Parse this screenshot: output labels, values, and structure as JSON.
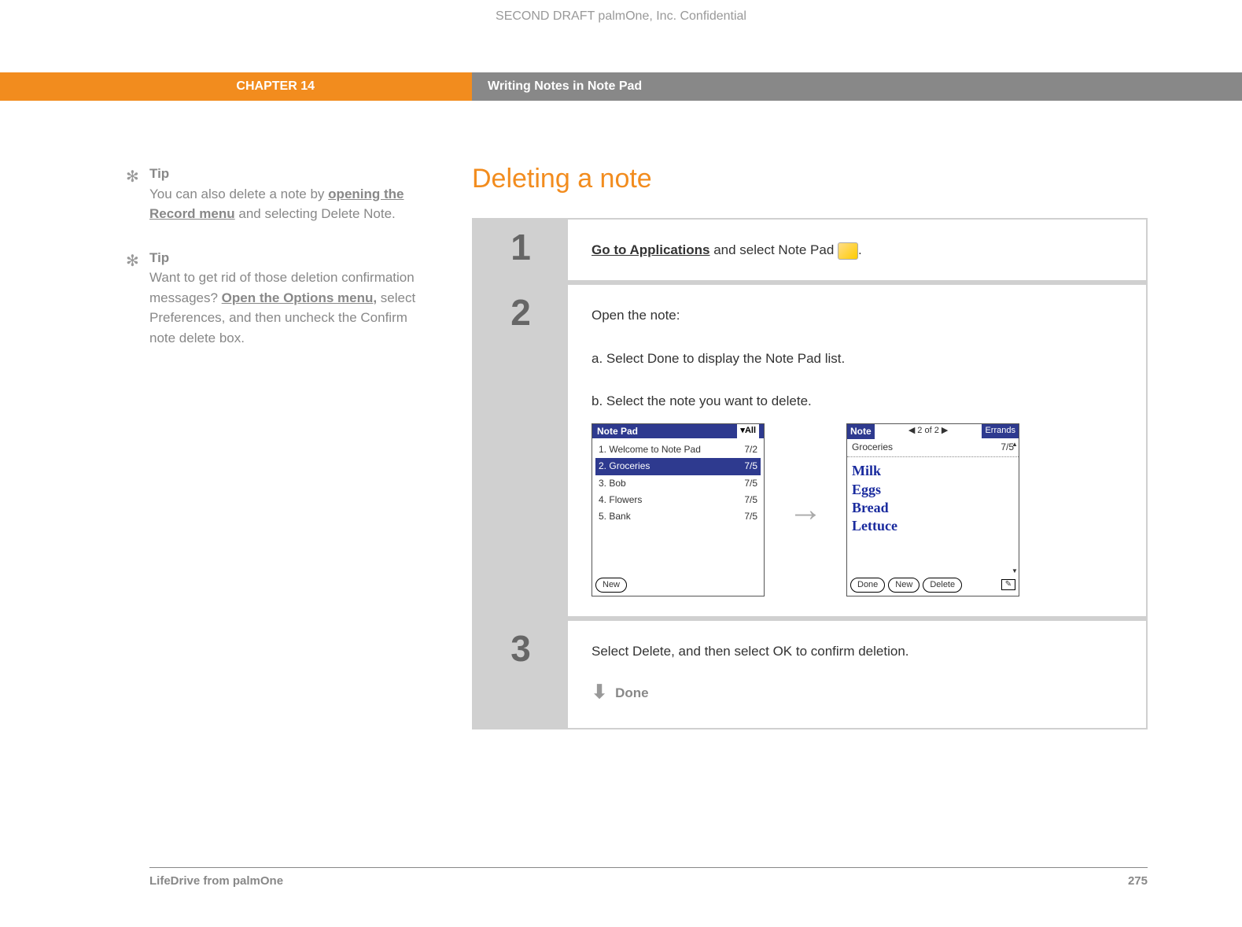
{
  "header": {
    "confidential": "SECOND DRAFT palmOne, Inc.  Confidential",
    "chapter": "CHAPTER 14",
    "chapter_title": "Writing Notes in Note Pad"
  },
  "sidebar": {
    "tips": [
      {
        "label": "Tip",
        "text_before": "You can also delete a note by ",
        "link": "opening the Record menu",
        "text_after": " and selecting Delete Note."
      },
      {
        "label": "Tip",
        "text_before": "Want to get rid of those deletion confirmation messages? ",
        "link": "Open the Options menu,",
        "text_after": " select Preferences, and then uncheck the Confirm note delete box."
      }
    ]
  },
  "main": {
    "title": "Deleting a note",
    "steps": [
      {
        "num": "1",
        "link": "Go to Applications",
        "text_after": " and select Note Pad ",
        "period": "."
      },
      {
        "num": "2",
        "intro": "Open the note:",
        "sub_a": "a.  Select Done to display the Note Pad list.",
        "sub_b": "b.  Select the note you want to delete."
      },
      {
        "num": "3",
        "text": "Select Delete, and then select OK to confirm deletion.",
        "done": "Done"
      }
    ]
  },
  "palm_list_screen": {
    "title": "Note Pad",
    "category": "All",
    "rows": [
      {
        "n": "1.",
        "name": "Welcome to Note Pad",
        "date": "7/2",
        "selected": false
      },
      {
        "n": "2.",
        "name": "Groceries",
        "date": "7/5",
        "selected": true
      },
      {
        "n": "3.",
        "name": "Bob",
        "date": "7/5",
        "selected": false
      },
      {
        "n": "4.",
        "name": "Flowers",
        "date": "7/5",
        "selected": false
      },
      {
        "n": "5.",
        "name": "Bank",
        "date": "7/5",
        "selected": false
      }
    ],
    "new_btn": "New"
  },
  "palm_note_screen": {
    "title": "Note",
    "position": "2 of 2",
    "category": "Errands",
    "note_title": "Groceries",
    "note_date": "7/5",
    "handwriting": [
      "Milk",
      "Eggs",
      "Bread",
      "Lettuce"
    ],
    "buttons": [
      "Done",
      "New",
      "Delete"
    ]
  },
  "arrow": "→",
  "footer": {
    "product": "LifeDrive from palmOne",
    "page": "275"
  }
}
